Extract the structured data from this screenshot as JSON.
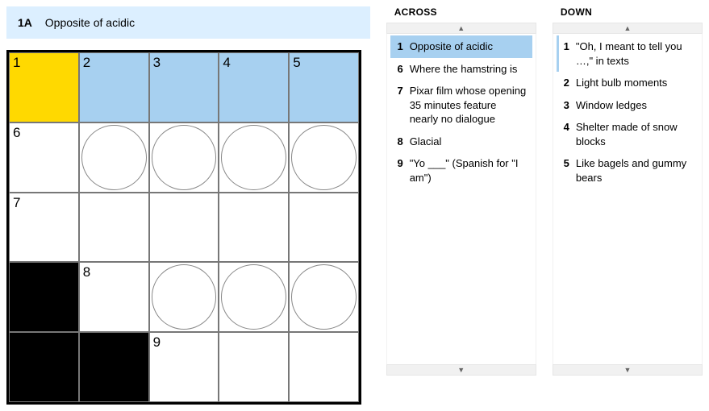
{
  "current_clue": {
    "label": "1A",
    "text": "Opposite of acidic"
  },
  "grid": {
    "size": 5,
    "cells": [
      {
        "r": 0,
        "c": 0,
        "num": "1",
        "state": "cursor"
      },
      {
        "r": 0,
        "c": 1,
        "num": "2",
        "state": "hl"
      },
      {
        "r": 0,
        "c": 2,
        "num": "3",
        "state": "hl"
      },
      {
        "r": 0,
        "c": 3,
        "num": "4",
        "state": "hl"
      },
      {
        "r": 0,
        "c": 4,
        "num": "5",
        "state": "hl"
      },
      {
        "r": 1,
        "c": 0,
        "num": "6"
      },
      {
        "r": 1,
        "c": 1,
        "circle": true
      },
      {
        "r": 1,
        "c": 2,
        "circle": true
      },
      {
        "r": 1,
        "c": 3,
        "circle": true
      },
      {
        "r": 1,
        "c": 4,
        "circle": true
      },
      {
        "r": 2,
        "c": 0,
        "num": "7"
      },
      {
        "r": 2,
        "c": 1
      },
      {
        "r": 2,
        "c": 2
      },
      {
        "r": 2,
        "c": 3
      },
      {
        "r": 2,
        "c": 4
      },
      {
        "r": 3,
        "c": 0,
        "state": "black"
      },
      {
        "r": 3,
        "c": 1,
        "num": "8"
      },
      {
        "r": 3,
        "c": 2,
        "circle": true
      },
      {
        "r": 3,
        "c": 3,
        "circle": true
      },
      {
        "r": 3,
        "c": 4,
        "circle": true
      },
      {
        "r": 4,
        "c": 0,
        "state": "black"
      },
      {
        "r": 4,
        "c": 1,
        "state": "black"
      },
      {
        "r": 4,
        "c": 2,
        "num": "9"
      },
      {
        "r": 4,
        "c": 3
      },
      {
        "r": 4,
        "c": 4
      }
    ]
  },
  "across": {
    "heading": "ACROSS",
    "clues": [
      {
        "n": "1",
        "t": "Opposite of acidic",
        "selected": true
      },
      {
        "n": "6",
        "t": "Where the hamstring is"
      },
      {
        "n": "7",
        "t": "Pixar film whose opening 35 minutes feature nearly no dialogue"
      },
      {
        "n": "8",
        "t": "Glacial"
      },
      {
        "n": "9",
        "t": "\"Yo ___\" (Spanish for \"I am\")"
      }
    ]
  },
  "down": {
    "heading": "DOWN",
    "clues": [
      {
        "n": "1",
        "t": "\"Oh, I meant to tell you …,\" in texts",
        "marker": true
      },
      {
        "n": "2",
        "t": "Light bulb moments"
      },
      {
        "n": "3",
        "t": "Window ledges"
      },
      {
        "n": "4",
        "t": "Shelter made of snow blocks"
      },
      {
        "n": "5",
        "t": "Like bagels and gummy bears"
      }
    ]
  }
}
